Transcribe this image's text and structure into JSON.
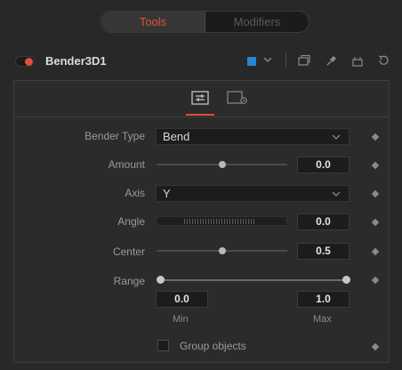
{
  "tabs": {
    "tools": "Tools",
    "modifiers": "Modifiers"
  },
  "header": {
    "tool_name": "Bender3D1",
    "color_chip": "#2a86d0",
    "accent": "#e0503a"
  },
  "controls": {
    "bender_type": {
      "label": "Bender Type",
      "value": "Bend"
    },
    "amount": {
      "label": "Amount",
      "value": "0.0",
      "fraction": 0.5
    },
    "axis": {
      "label": "Axis",
      "value": "Y"
    },
    "angle": {
      "label": "Angle",
      "value": "0.0"
    },
    "center": {
      "label": "Center",
      "value": "0.5",
      "fraction": 0.5
    },
    "range": {
      "label": "Range",
      "min_value": "0.0",
      "max_value": "1.0",
      "min_label": "Min",
      "max_label": "Max"
    },
    "group_objects": {
      "label": "Group objects",
      "checked": false
    }
  }
}
